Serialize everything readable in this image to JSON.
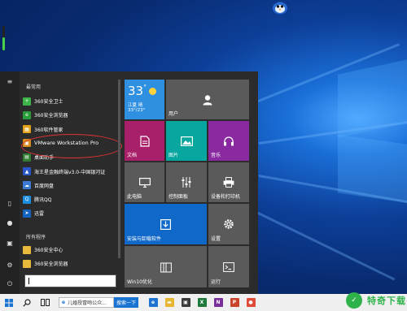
{
  "desktop": {
    "mascot_icon": "penguin-icon",
    "gauge": {
      "percent": 55,
      "color": "#48d34a"
    }
  },
  "start_menu": {
    "rail_icons": [
      "hamburger-icon",
      "tablet-icon",
      "user-icon",
      "picture-icon",
      "gear-icon",
      "power-icon"
    ],
    "most_used_title": "最常用",
    "most_used": [
      {
        "label": "360安全卫士",
        "icon": "shield-icon",
        "color": "#3cb44a",
        "glyph": "+"
      },
      {
        "label": "360安全浏览器",
        "icon": "browser-icon",
        "color": "#2a9d3a",
        "glyph": "e"
      },
      {
        "label": "360软件管家",
        "icon": "grid-icon",
        "color": "#e3a21a",
        "glyph": "▦"
      },
      {
        "label": "VMware Workstation Pro",
        "icon": "vmware-icon",
        "color": "#d68b1c",
        "glyph": "▣"
      },
      {
        "label": "桌面助手",
        "icon": "desktop-icon",
        "color": "#2e7d32",
        "glyph": "▤"
      },
      {
        "label": "海王星金融终端v3.0-中国银河证",
        "icon": "finance-icon",
        "color": "#2b56c7",
        "glyph": "▲"
      },
      {
        "label": "百度网盘",
        "icon": "cloud-icon",
        "color": "#3a7bd5",
        "glyph": "☁"
      },
      {
        "label": "腾讯QQ",
        "icon": "qq-icon",
        "color": "#1d8fe1",
        "glyph": "Q"
      },
      {
        "label": "迅雷",
        "icon": "thunder-icon",
        "color": "#1565c0",
        "glyph": "➤"
      }
    ],
    "all_apps_title": "所有程序",
    "all_apps": [
      {
        "label": "360安全中心",
        "icon": "folder-icon",
        "color": "#e8b93a",
        "glyph": ""
      },
      {
        "label": "360安全浏览器",
        "icon": "folder-icon",
        "color": "#e8b93a",
        "glyph": ""
      }
    ],
    "search_value": ""
  },
  "tiles": {
    "weather": {
      "temp": "33",
      "deg": "°",
      "city": "江夏 晴",
      "range": "33°/23°"
    },
    "user": {
      "label": "用户",
      "icon": "user-icon"
    },
    "documents": {
      "label": "文档",
      "icon": "document-icon"
    },
    "pictures": {
      "label": "图片",
      "icon": "picture-icon"
    },
    "music": {
      "label": "音乐",
      "icon": "headphones-icon"
    },
    "this_pc": {
      "label": "此电脑",
      "icon": "monitor-icon"
    },
    "control_panel": {
      "label": "控制面板",
      "icon": "sliders-icon"
    },
    "devices": {
      "label": "设备和打印机",
      "icon": "printer-icon"
    },
    "install": {
      "label": "安装与卸载软件",
      "icon": "install-icon"
    },
    "settings": {
      "label": "设置",
      "icon": "gear-icon"
    },
    "win10": {
      "label": "Win10优化",
      "icon": "optimize-icon"
    },
    "run": {
      "label": "运行",
      "icon": "run-icon"
    }
  },
  "taskbar": {
    "start_icon": "windows-icon",
    "search_icon": "search-icon",
    "taskview_icon": "taskview-icon",
    "address_text": "儿婚授冒吻公众...",
    "search_button": "搜索一下",
    "apps": [
      {
        "icon": "edge-icon",
        "color": "#1e73d2",
        "glyph": "e"
      },
      {
        "icon": "file-explorer-icon",
        "color": "#e6b532",
        "glyph": "▬"
      },
      {
        "icon": "store-icon",
        "color": "#3a3a3a",
        "glyph": "▣"
      },
      {
        "icon": "excel-icon",
        "color": "#1f7a3c",
        "glyph": "X"
      },
      {
        "icon": "onenote-icon",
        "color": "#7b2f98",
        "glyph": "N"
      },
      {
        "icon": "powerpoint-icon",
        "color": "#c8462b",
        "glyph": "P"
      },
      {
        "icon": "chrome-icon",
        "color": "#dd4b39",
        "glyph": "●"
      }
    ]
  },
  "watermark": {
    "text": "特奇下载",
    "logo": "watermark-logo-icon"
  }
}
